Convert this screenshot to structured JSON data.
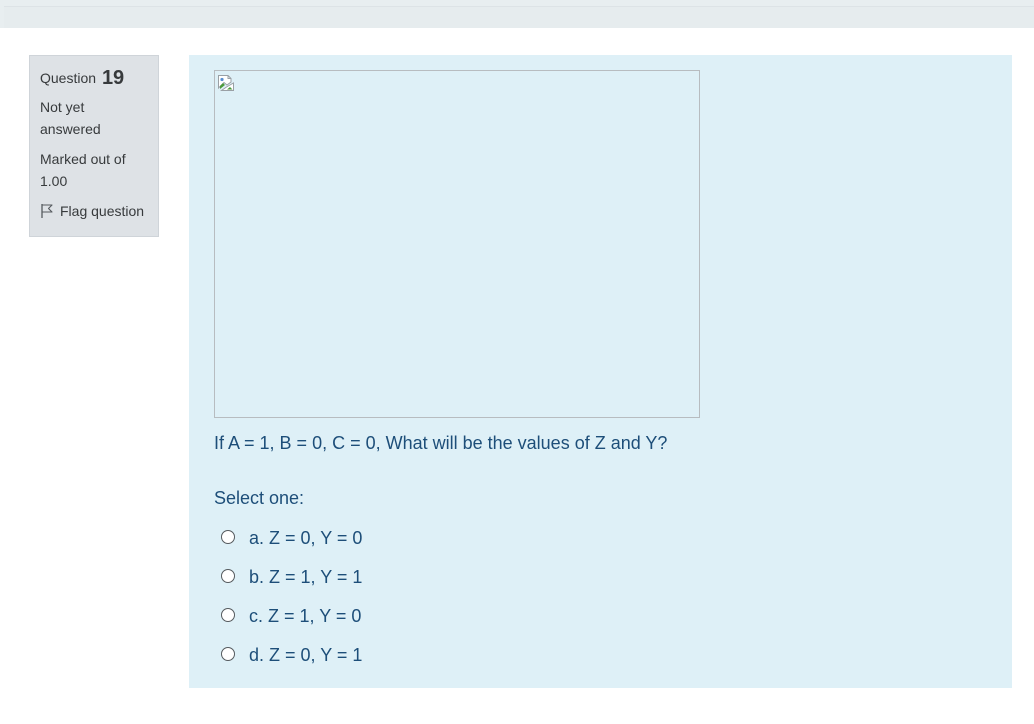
{
  "info": {
    "question_word": "Question",
    "question_number": "19",
    "state_line1": "Not yet",
    "state_line2": "answered",
    "grade_line1": "Marked out of",
    "grade_line2": "1.00",
    "flag_label": "Flag question",
    "flag_icon": "flag-icon"
  },
  "question": {
    "image_icon": "broken-image-icon",
    "text": "If A = 1, B = 0, C = 0, What will be the values of Z and Y?",
    "prompt": "Select one:",
    "options": [
      {
        "label": "a. Z = 0, Y = 0"
      },
      {
        "label": "b. Z = 1, Y = 1"
      },
      {
        "label": "c. Z = 1, Y = 0"
      },
      {
        "label": "d. Z = 0, Y = 1"
      }
    ]
  },
  "colors": {
    "info_bg": "#dee2e6",
    "content_bg": "#def0f7",
    "question_text": "#1d4e79"
  }
}
